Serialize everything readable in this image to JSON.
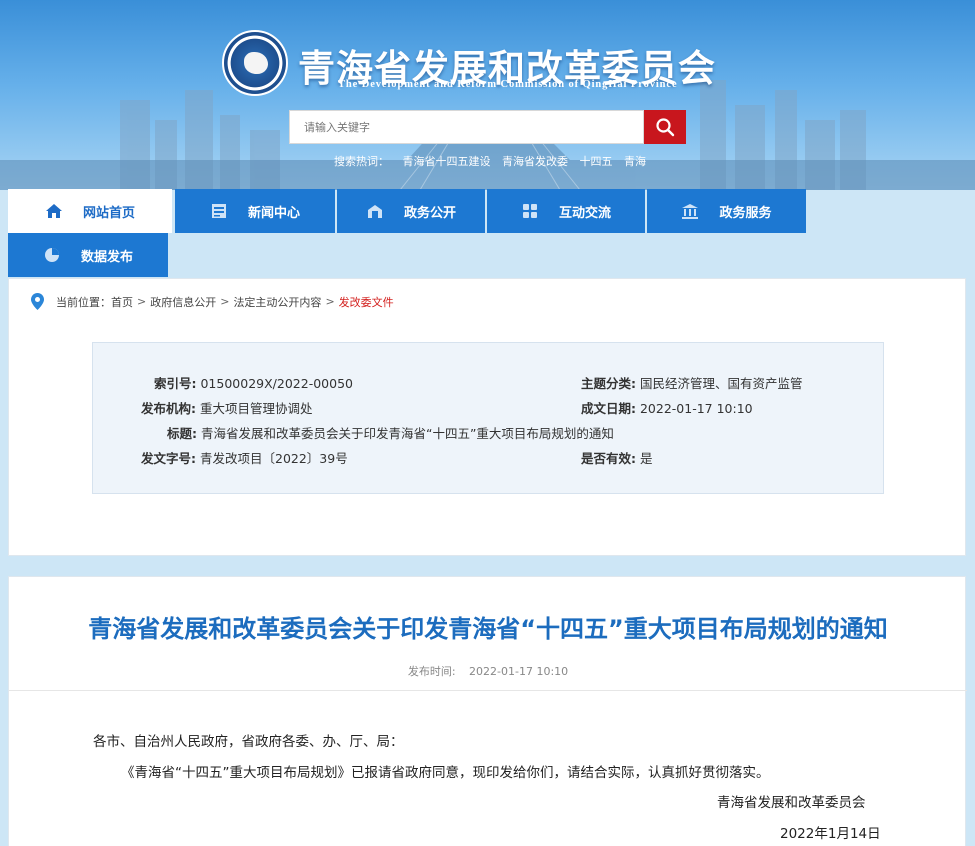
{
  "header": {
    "title": "青海省发展和改革委员会",
    "subtitle": "The Development and Reform Commission of QingHai Province",
    "search_placeholder": "请输入关键字",
    "hot_label": "搜索热词：",
    "hot_words": [
      "青海省十四五建设",
      "青海省发改委",
      "十四五",
      "青海"
    ]
  },
  "nav": {
    "items": [
      {
        "label": "网站首页",
        "icon": "home-icon"
      },
      {
        "label": "新闻中心",
        "icon": "newspaper-icon"
      },
      {
        "label": "政务公开",
        "icon": "open-box-icon"
      },
      {
        "label": "互动交流",
        "icon": "grid-icon"
      },
      {
        "label": "政务服务",
        "icon": "bank-icon"
      },
      {
        "label": "数据发布",
        "icon": "pie-chart-icon"
      }
    ]
  },
  "breadcrumb": {
    "label": "当前位置：",
    "items": [
      "首页",
      "政府信息公开",
      "法定主动公开内容",
      "发改委文件"
    ]
  },
  "meta": {
    "index_label": "索引号:",
    "index_value": "01500029X/2022-00050",
    "topic_label": "主题分类:",
    "topic_value": "国民经济管理、国有资产监管",
    "org_label": "发布机构:",
    "org_value": "重大项目管理协调处",
    "date_label": "成文日期:",
    "date_value": "2022-01-17 10:10",
    "subject_label": "标题:",
    "subject_value": "青海省发展和改革委员会关于印发青海省“十四五”重大项目布局规划的通知",
    "docno_label": "发文字号:",
    "docno_value": "青发改项目〔2022〕39号",
    "valid_label": "是否有效:",
    "valid_value": "是"
  },
  "article": {
    "title": "青海省发展和改革委员会关于印发青海省“十四五”重大项目布局规划的通知",
    "date_label": "发布时间:",
    "date_value": "2022-01-17 10:10",
    "greeting": "各市、自治州人民政府，省政府各委、办、厅、局：",
    "body": "《青海省“十四五”重大项目布局规划》已报请省政府同意，现印发给你们，请结合实际，认真抓好贯彻落实。",
    "signature": "青海省发展和改革委员会",
    "sign_date": "2022年1月14日"
  },
  "colors": {
    "accent": "#1d78d2",
    "title": "#1c6cbe",
    "search_button": "#c8161d",
    "current_crumb": "#d3211f"
  }
}
